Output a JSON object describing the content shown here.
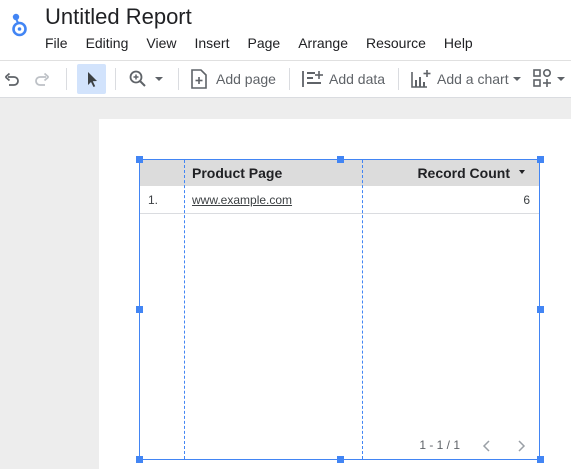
{
  "app": {
    "title": "Untitled Report",
    "logo_icon": "looker-studio-logo",
    "accent_color": "#4285f4"
  },
  "menu": {
    "items": [
      "File",
      "Editing",
      "View",
      "Insert",
      "Page",
      "Arrange",
      "Resource",
      "Help"
    ]
  },
  "toolbar": {
    "undo_icon": "undo-icon",
    "redo_icon": "redo-icon",
    "select_icon": "pointer-icon",
    "zoom_icon": "zoom-icon",
    "add_page_label": "Add page",
    "add_data_label": "Add data",
    "add_chart_label": "Add a chart",
    "add_control_icon": "add-control-icon"
  },
  "table": {
    "columns": [
      "Product Page",
      "Record Count"
    ],
    "sort_column": "Record Count",
    "sort_direction": "descending",
    "rows": [
      {
        "index": "1.",
        "product_page": "www.example.com",
        "record_count": "6"
      }
    ],
    "pagination": "1 - 1 / 1"
  }
}
